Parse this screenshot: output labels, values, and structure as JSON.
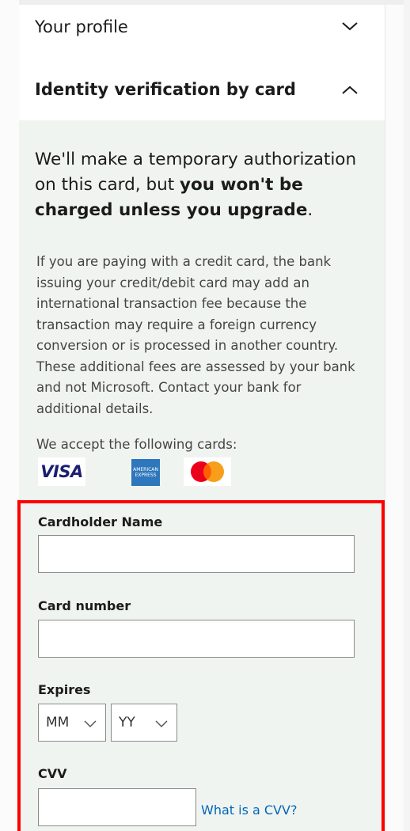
{
  "accordion": {
    "profile_label": "Your profile",
    "identity_label": "Identity verification by card"
  },
  "intro": {
    "part1": "We'll make a temporary authorization on this card, but ",
    "bold": "you won't be charged unless you upgrade",
    "part2": "."
  },
  "disclaimer": "If you are paying with a credit card, the bank issuing your credit/debit card may add an international transaction fee because the transaction may require a foreign currency conversion or is processed in another country. These additional fees are assessed by your bank and not Microsoft. Contact your bank for additional details.",
  "accepted_cards": {
    "label": "We accept the following cards:",
    "visa_text": "VISA",
    "amex_text": "AMERICAN EXPRESS",
    "cards": [
      "visa",
      "american-express",
      "mastercard"
    ]
  },
  "form": {
    "cardholder_label": "Cardholder Name",
    "cardholder_value": "",
    "card_number_label": "Card number",
    "card_number_value": "",
    "expires_label": "Expires",
    "month_value": "MM",
    "year_value": "YY",
    "cvv_label": "CVV",
    "cvv_value": "",
    "cvv_help_link": "What is a CVV?"
  },
  "colors": {
    "panel_bg": "#f0f4f0",
    "highlight_border": "#ff0000",
    "link": "#0067b8",
    "visa_blue": "#1a1f71",
    "amex_blue": "#2e77bc",
    "mc_red": "#eb001b",
    "mc_orange": "#f79e1b"
  }
}
